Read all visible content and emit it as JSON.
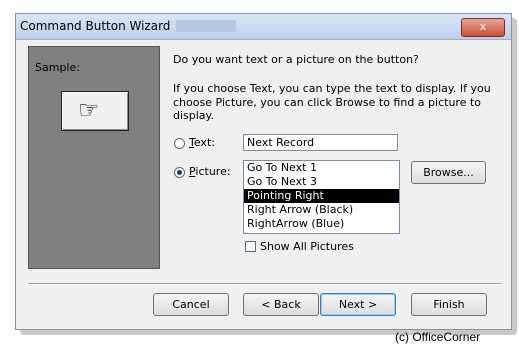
{
  "window": {
    "title": "Command Button Wizard",
    "close_label": "x"
  },
  "sample": {
    "label": "Sample:",
    "button_icon": "pointing-hand-icon"
  },
  "question": "Do you want text or a picture on the button?",
  "help_line1": "If you choose Text, you can type the text to display.  If you",
  "help_line2": "choose Picture, you can click Browse to find a picture to display.",
  "text_option": {
    "label": "Text:",
    "value": "Next Record",
    "selected": false
  },
  "picture_option": {
    "label": "Picture:",
    "selected": true
  },
  "picture_list": {
    "items": [
      "Go To Next 1",
      "Go To Next 3",
      "Pointing Right",
      "Right Arrow (Black)",
      "RightArrow (Blue)"
    ],
    "selected": "Pointing Right"
  },
  "browse_label": "Browse...",
  "show_all_pictures": {
    "label": "Show All Pictures",
    "checked": false
  },
  "buttons": {
    "cancel": "Cancel",
    "back": "< Back",
    "next": "Next >",
    "finish": "Finish"
  },
  "watermark": "(c) OfficeCorner"
}
